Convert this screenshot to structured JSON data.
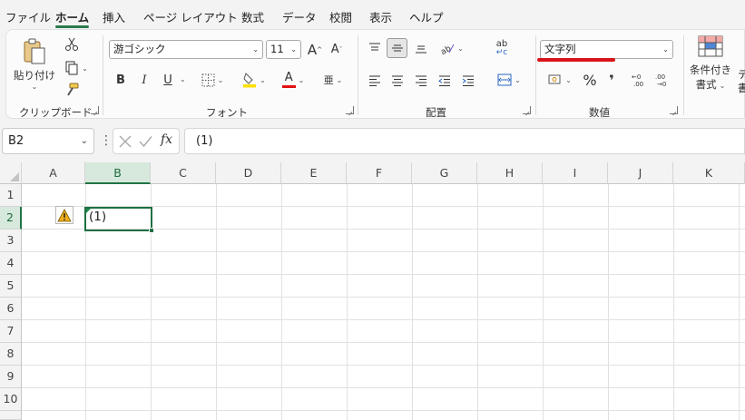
{
  "menu": {
    "tabs": [
      "ファイル",
      "ホーム",
      "挿入",
      "ページ レイアウト",
      "数式",
      "データ",
      "校閲",
      "表示",
      "ヘルプ"
    ],
    "active": "ホーム"
  },
  "ribbon": {
    "clipboard": {
      "paste_label": "貼り付け",
      "group_label": "クリップボード"
    },
    "font": {
      "font_name": "游ゴシック",
      "font_size": "11",
      "grow_label": "A",
      "shrink_label": "A",
      "bold": "B",
      "italic": "I",
      "underline": "U",
      "font_color_letter": "A",
      "phonetic_label": "亜",
      "group_label": "フォント",
      "highlight_color": "#ffe000",
      "font_color": "#e01010"
    },
    "alignment": {
      "group_label": "配置",
      "wrap_label": "ab"
    },
    "number": {
      "format_value": "文字列",
      "percent": "%",
      "comma": "❜",
      "group_label": "数値"
    },
    "styles": {
      "conditional_label_line1": "条件付き",
      "conditional_label_line2": "書式",
      "next_label_line1": "テ",
      "next_label_line2": "書"
    }
  },
  "formula_bar": {
    "name_box": "B2",
    "fx_label": "fx",
    "formula": "(1)"
  },
  "sheet": {
    "columns": [
      "A",
      "B",
      "C",
      "D",
      "E",
      "F",
      "G",
      "H",
      "I",
      "J",
      "K"
    ],
    "rows": [
      "1",
      "2",
      "3",
      "4",
      "5",
      "6",
      "7",
      "8",
      "9",
      "10"
    ],
    "selected_column": "B",
    "selected_row": "2",
    "cell_b2": "(1)",
    "accent_color": "#217346"
  }
}
